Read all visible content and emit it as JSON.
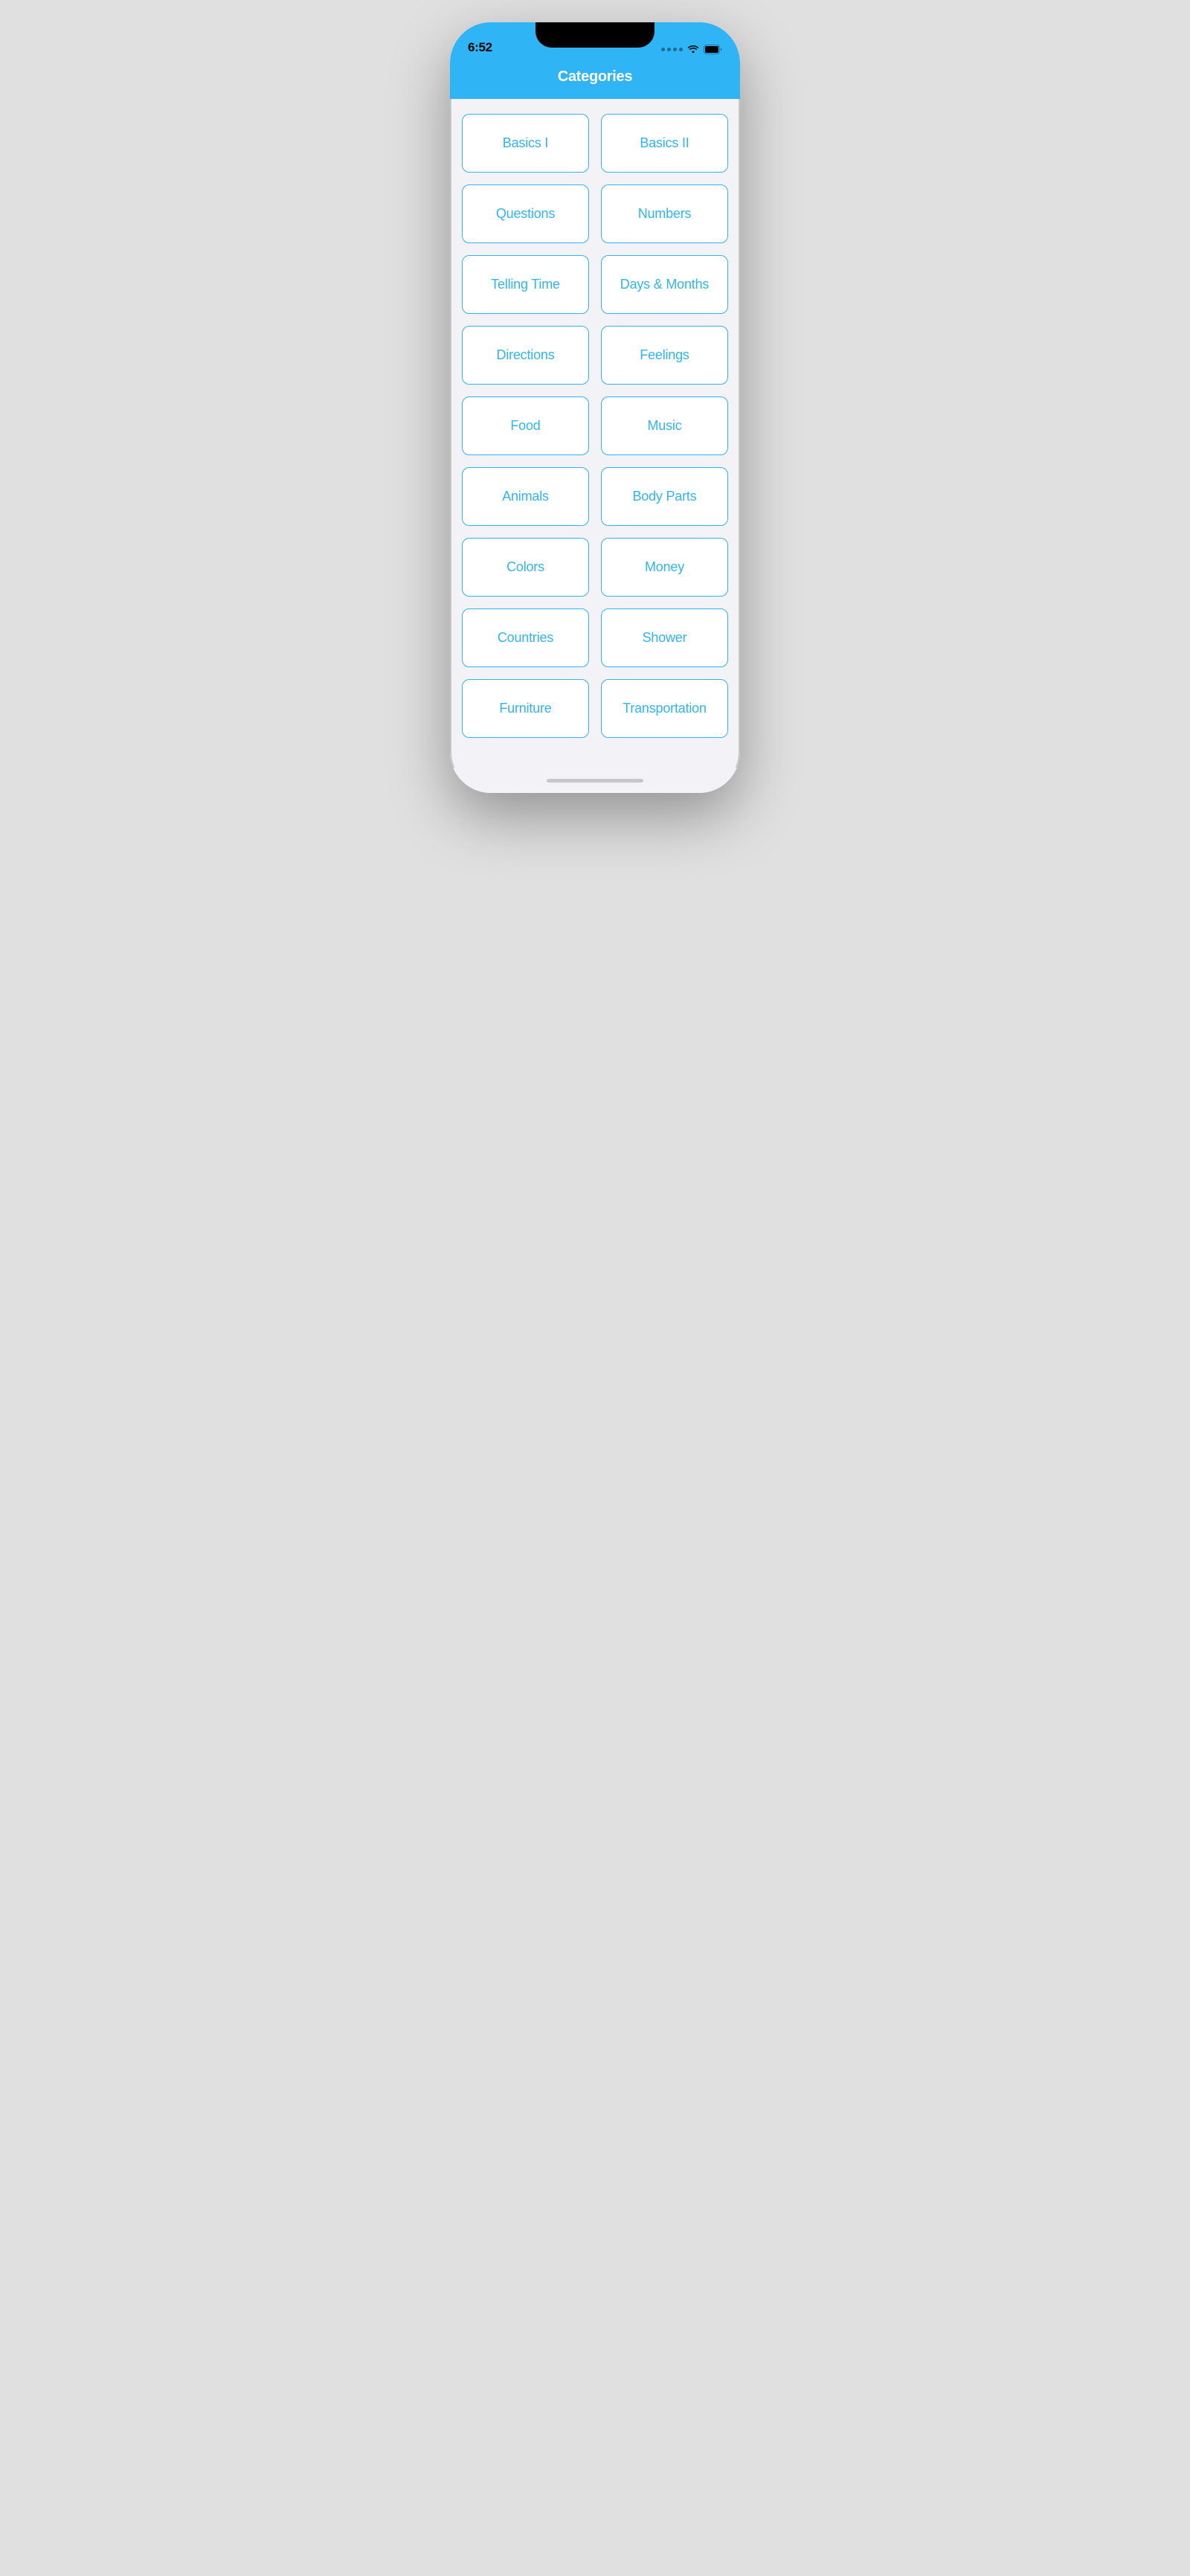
{
  "statusBar": {
    "time": "6:52",
    "signalDots": 4,
    "batteryLabel": "🔋"
  },
  "header": {
    "title": "Categories"
  },
  "categories": [
    {
      "label": "Basics I"
    },
    {
      "label": "Basics II"
    },
    {
      "label": "Questions"
    },
    {
      "label": "Numbers"
    },
    {
      "label": "Telling Time"
    },
    {
      "label": "Days & Months"
    },
    {
      "label": "Directions"
    },
    {
      "label": "Feelings"
    },
    {
      "label": "Food"
    },
    {
      "label": "Music"
    },
    {
      "label": "Animals"
    },
    {
      "label": "Body Parts"
    },
    {
      "label": "Colors"
    },
    {
      "label": "Money"
    },
    {
      "label": "Countries"
    },
    {
      "label": "Shower"
    },
    {
      "label": "Furniture"
    },
    {
      "label": "Transportation"
    }
  ]
}
